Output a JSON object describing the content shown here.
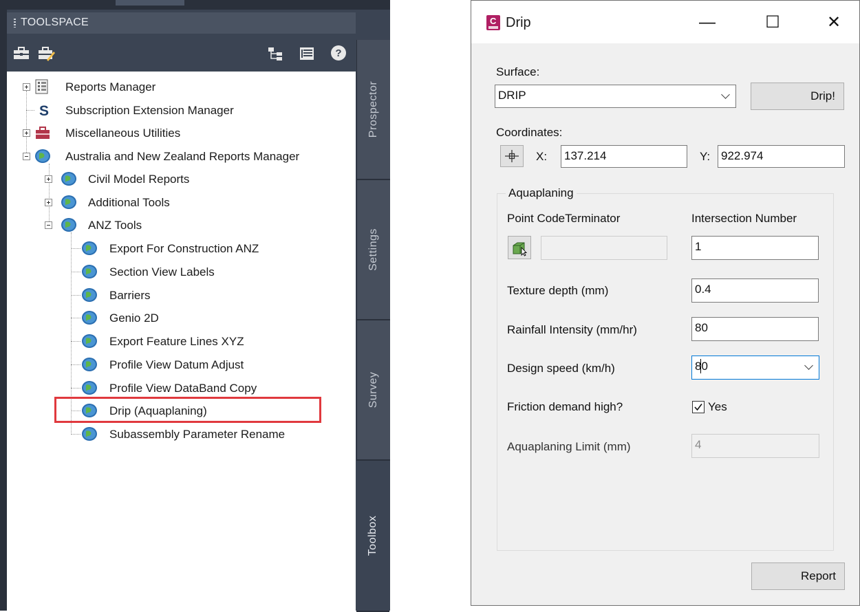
{
  "toolspace": {
    "title": "TOOLSPACE",
    "tabs": [
      "Prospector",
      "Settings",
      "Survey",
      "Toolbox"
    ],
    "active_tab": "Toolbox",
    "tree": {
      "reports_manager": "Reports Manager",
      "subscription_extension_manager": "Subscription Extension Manager",
      "miscellaneous_utilities": "Miscellaneous Utilities",
      "anz_reports_manager": "Australia and New Zealand Reports Manager",
      "civil_model_reports": "Civil Model Reports",
      "additional_tools": "Additional Tools",
      "anz_tools": "ANZ Tools",
      "anz_tools_items": [
        "Export For Construction ANZ",
        "Section View Labels",
        "Barriers",
        "Genio 2D",
        "Export Feature Lines XYZ",
        "Profile View Datum Adjust",
        "Profile View DataBand Copy",
        "Drip (Aquaplaning)",
        "Subassembly Parameter Rename"
      ],
      "highlighted_item": "Drip (Aquaplaning)"
    }
  },
  "dialog": {
    "title": "Drip",
    "app_icon_letter": "C",
    "window_buttons": {
      "minimize": "—",
      "maximize": "☐",
      "close": "✕"
    },
    "surface_label": "Surface:",
    "surface_value": "DRIP",
    "drip_button": "Drip!",
    "coordinates_label": "Coordinates:",
    "x_label": "X:",
    "x_value": "137.214",
    "y_label": "Y:",
    "y_value": "922.974",
    "group_title": "Aquaplaning",
    "point_code_terminator_label": "Point CodeTerminator",
    "point_code_value": "",
    "intersection_number_label": "Intersection Number",
    "intersection_number_value": "1",
    "texture_depth_label": "Texture depth (mm)",
    "texture_depth_value": "0.4",
    "rainfall_intensity_label": "Rainfall Intensity (mm/hr)",
    "rainfall_intensity_value": "80",
    "design_speed_label": "Design speed (km/h)",
    "design_speed_value": "80",
    "friction_demand_label": "Friction demand high?",
    "friction_demand_checkbox_label": "Yes",
    "friction_demand_checked": true,
    "aquaplaning_limit_label": "Aquaplaning Limit (mm)",
    "aquaplaning_limit_value": "4",
    "report_button": "Report"
  }
}
